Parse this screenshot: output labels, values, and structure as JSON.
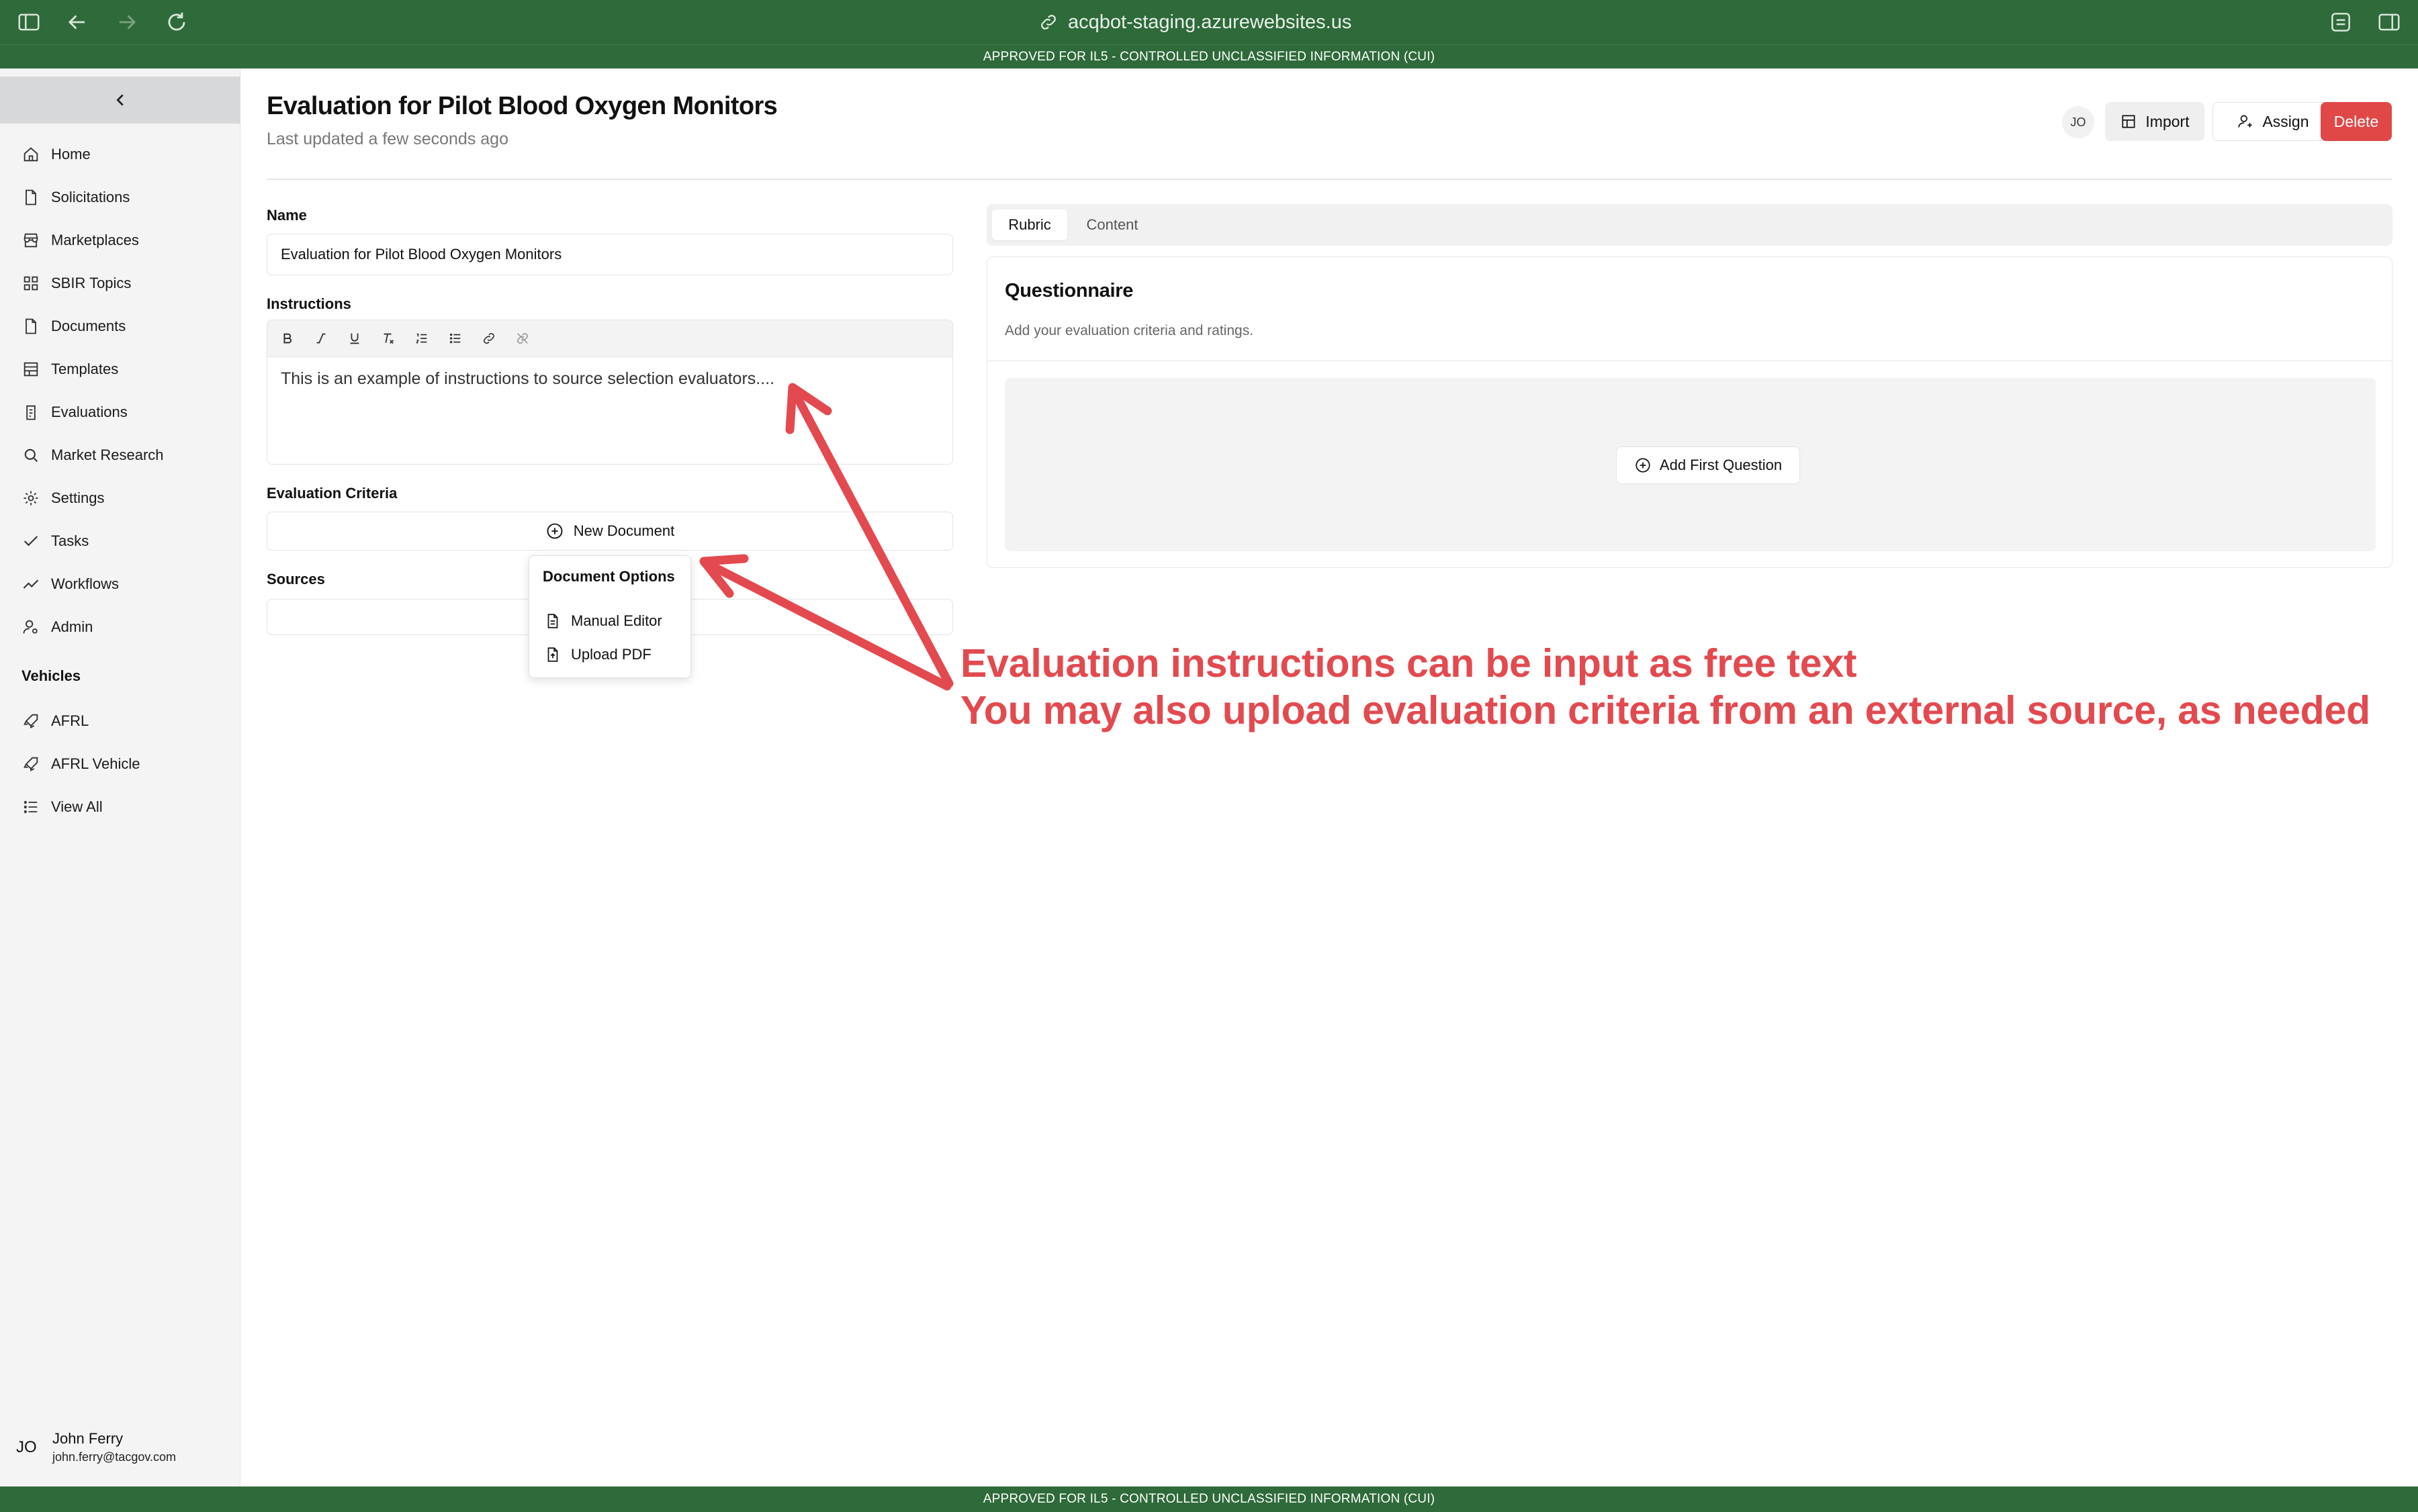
{
  "browser": {
    "url": "acqbot-staging.azurewebsites.us",
    "icons": [
      "sidebar-toggle-icon",
      "back-icon",
      "forward-icon",
      "reload-icon",
      "link-icon",
      "extensions-icon",
      "split-view-icon"
    ]
  },
  "banner": {
    "text": "APPROVED FOR IL5 - CONTROLLED UNCLASSIFIED INFORMATION (CUI)"
  },
  "sidebar": {
    "items": [
      {
        "label": "Home",
        "icon": "home-icon"
      },
      {
        "label": "Solicitations",
        "icon": "file-icon"
      },
      {
        "label": "Marketplaces",
        "icon": "store-icon"
      },
      {
        "label": "SBIR Topics",
        "icon": "grid-icon"
      },
      {
        "label": "Documents",
        "icon": "file-icon"
      },
      {
        "label": "Templates",
        "icon": "template-icon"
      },
      {
        "label": "Evaluations",
        "icon": "clipboard-icon"
      },
      {
        "label": "Market Research",
        "icon": "search-icon"
      },
      {
        "label": "Settings",
        "icon": "gear-icon"
      },
      {
        "label": "Tasks",
        "icon": "check-icon"
      },
      {
        "label": "Workflows",
        "icon": "trend-icon"
      },
      {
        "label": "Admin",
        "icon": "user-gear-icon"
      }
    ],
    "vehicles_heading": "Vehicles",
    "vehicles": [
      {
        "label": "AFRL",
        "icon": "rocket-icon"
      },
      {
        "label": "AFRL Vehicle",
        "icon": "rocket-icon"
      },
      {
        "label": "View All",
        "icon": "list-icon"
      }
    ],
    "user": {
      "initials": "JO",
      "name": "John Ferry",
      "email": "john.ferry@tacgov.com"
    }
  },
  "header": {
    "title": "Evaluation for Pilot Blood Oxygen Monitors",
    "subtitle": "Last updated a few seconds ago",
    "avatar_initials": "JO",
    "import_label": "Import",
    "assign_label": "Assign",
    "delete_label": "Delete",
    "delete_color": "#e04848"
  },
  "form": {
    "name_label": "Name",
    "name_value": "Evaluation for Pilot Blood Oxygen Monitors",
    "instructions_label": "Instructions",
    "toolbar": [
      "bold-icon",
      "italic-icon",
      "underline-icon",
      "clear-format-icon",
      "ordered-list-icon",
      "bullet-list-icon",
      "link-icon",
      "unlink-icon"
    ],
    "instructions_value": "This is an example of instructions to source selection evaluators....",
    "criteria_label": "Evaluation Criteria",
    "new_document_label": "New Document",
    "sources_label": "Sources"
  },
  "dropdown": {
    "title": "Document Options",
    "items": [
      {
        "label": "Manual Editor",
        "icon": "document-icon"
      },
      {
        "label": "Upload PDF",
        "icon": "pdf-upload-icon"
      }
    ]
  },
  "panel": {
    "tabs": [
      "Rubric",
      "Content"
    ],
    "active_tab": "Rubric",
    "card_title": "Questionnaire",
    "card_subtitle": "Add your evaluation criteria and ratings.",
    "add_question_label": "Add First Question"
  },
  "annotation": {
    "line1": "Evaluation instructions can be input as free text",
    "line2": "You may also upload evaluation criteria from an external source, as needed",
    "color": "#e24a4f"
  }
}
